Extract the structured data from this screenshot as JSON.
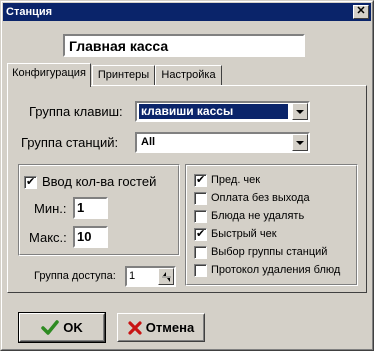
{
  "window": {
    "title": "Станция",
    "close_glyph": "✕"
  },
  "station_name": "Главная касса",
  "tabs": [
    {
      "label": "Конфигурация"
    },
    {
      "label": "Принтеры"
    },
    {
      "label": "Настройка"
    }
  ],
  "config": {
    "key_group_label": "Группа клавиш:",
    "key_group_value": "клавиши кассы",
    "station_group_label": "Группа станций:",
    "station_group_value": "All",
    "guest_count_label": "Ввод кол-ва гостей",
    "guest_count_checked": true,
    "min_label": "Мин.:",
    "min_value": "1",
    "max_label": "Макс.:",
    "max_value": "10",
    "access_group_label": "Группа доступа:",
    "access_group_value": "1",
    "options": [
      {
        "label": "Пред. чек",
        "checked": true
      },
      {
        "label": "Оплата без выхода",
        "checked": false
      },
      {
        "label": "Блюда не удалять",
        "checked": false
      },
      {
        "label": "Быстрый чек",
        "checked": true
      },
      {
        "label": "Выбор группы станций",
        "checked": false
      },
      {
        "label": "Протокол удаления блюд",
        "checked": false
      }
    ]
  },
  "buttons": {
    "ok_label": "OK",
    "cancel_label": "Отмена"
  },
  "colors": {
    "titlebar": "#0a246a",
    "face": "#d4d0c8",
    "ok_icon": "#2e8b22",
    "cancel_icon": "#c81414"
  },
  "icons": {
    "ok": "checkmark-icon",
    "cancel": "cross-icon"
  }
}
